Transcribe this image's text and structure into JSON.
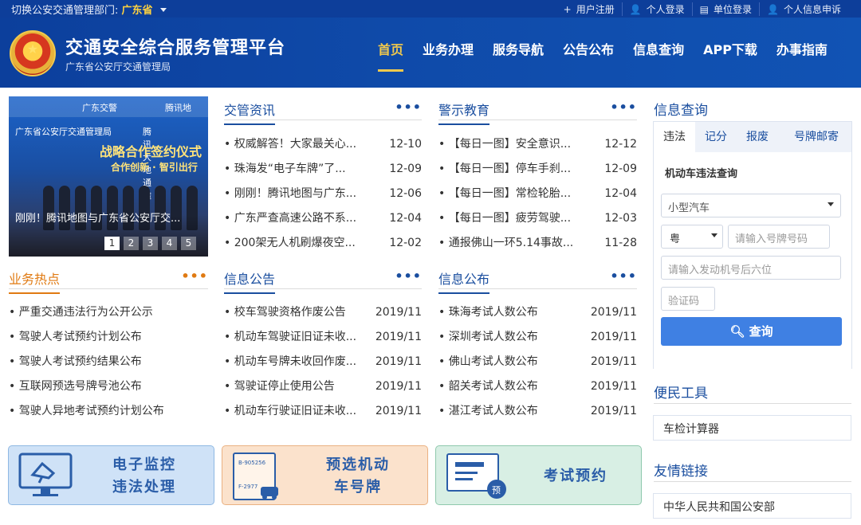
{
  "topbar": {
    "dept_prefix": "切换公安交通管理部门:",
    "dept_name": "广东省",
    "links": [
      {
        "icon": "+",
        "label": "用户注册"
      },
      {
        "icon": "👤",
        "label": "个人登录"
      },
      {
        "icon": "▤",
        "label": "单位登录"
      },
      {
        "icon": "👤",
        "label": "个人信息申诉"
      }
    ]
  },
  "header": {
    "title": "交通安全综合服务管理平台",
    "subtitle": "广东省公安厅交通管理局",
    "nav": [
      "首页",
      "业务办理",
      "服务导航",
      "公告公布",
      "信息查询",
      "APP下载",
      "办事指南"
    ],
    "active_nav": "首页"
  },
  "banner": {
    "logo_left": "广东交警",
    "logo_right": "腾讯地",
    "line_left": "广东省公安厅交通管理局",
    "line_right": "腾讯大地通途",
    "headline": "战略合作签约仪式",
    "subheadline": "合作创新 · 智引出行",
    "caption": "刚刚！腾讯地图与广东省公安厅交...",
    "pages": [
      "1",
      "2",
      "3",
      "4",
      "5"
    ],
    "active_page": "1"
  },
  "news": {
    "title": "交管资讯",
    "more": "•••",
    "items": [
      {
        "text": "权威解答！大家最关心...",
        "date": "12-10"
      },
      {
        "text": "珠海发“电子车牌”了...",
        "date": "12-09"
      },
      {
        "text": "刚刚！腾讯地图与广东...",
        "date": "12-06"
      },
      {
        "text": "广东严查高速公路不系...",
        "date": "12-04"
      },
      {
        "text": "200架无人机刷爆夜空...",
        "date": "12-02"
      }
    ]
  },
  "warning": {
    "title": "警示教育",
    "more": "•••",
    "items": [
      {
        "text": "【每日一图】安全意识...",
        "date": "12-12"
      },
      {
        "text": "【每日一图】停车手刹...",
        "date": "12-09"
      },
      {
        "text": "【每日一图】常检轮胎...",
        "date": "12-04"
      },
      {
        "text": "【每日一图】疲劳驾驶...",
        "date": "12-03"
      },
      {
        "text": "通报佛山一环5.14事故...",
        "date": "11-28"
      }
    ]
  },
  "hot": {
    "title": "业务热点",
    "more": "•••",
    "items": [
      "严重交通违法行为公开公示",
      "驾驶人考试预约计划公布",
      "驾驶人考试预约结果公布",
      "互联网预选号牌号池公布",
      "驾驶人异地考试预约计划公布"
    ]
  },
  "notice": {
    "title": "信息公告",
    "more": "•••",
    "items": [
      {
        "text": "校车驾驶资格作废公告",
        "date": "2019/11"
      },
      {
        "text": "机动车驾驶证旧证未收...",
        "date": "2019/11"
      },
      {
        "text": "机动车号牌未收回作废...",
        "date": "2019/11"
      },
      {
        "text": "驾驶证停止使用公告",
        "date": "2019/11"
      },
      {
        "text": "机动车行驶证旧证未收...",
        "date": "2019/11"
      }
    ]
  },
  "publish": {
    "title": "信息公布",
    "more": "•••",
    "items": [
      {
        "text": "珠海考试人数公布",
        "date": "2019/11"
      },
      {
        "text": "深圳考试人数公布",
        "date": "2019/11"
      },
      {
        "text": "佛山考试人数公布",
        "date": "2019/11"
      },
      {
        "text": "韶关考试人数公布",
        "date": "2019/11"
      },
      {
        "text": "湛江考试人数公布",
        "date": "2019/11"
      }
    ]
  },
  "query": {
    "title": "信息查询",
    "tabs": [
      "违法",
      "记分",
      "报废",
      "号牌邮寄"
    ],
    "active_tab": "违法",
    "subtitle": "机动车违法查询",
    "vehicle_type": "小型汽车",
    "province": "粤",
    "plate_placeholder": "请输入号牌号码",
    "engine_placeholder": "请输入发动机号后六位",
    "captcha_placeholder": "验证码",
    "button": "查询"
  },
  "tools": {
    "title": "便民工具",
    "items": [
      "车检计算器"
    ]
  },
  "links": {
    "title": "友情链接",
    "items": [
      "中华人民共和国公安部"
    ]
  },
  "cards": [
    {
      "label_1": "电子监控",
      "label_2": "违法处理",
      "bg": "#cfe2f7",
      "border": "#8fb8e3",
      "color": "#2a5da8"
    },
    {
      "label_1": "预选机动",
      "label_2": "车号牌",
      "bg": "#fbe2cc",
      "border": "#eab182",
      "color": "#2a5da8",
      "plate_1": "B-905256",
      "plate_2": "F-2977"
    },
    {
      "label_1": "考试预约",
      "label_2": "",
      "bg": "#d8efe4",
      "border": "#8fc9ad",
      "color": "#2a5da8",
      "badge": "预"
    }
  ]
}
